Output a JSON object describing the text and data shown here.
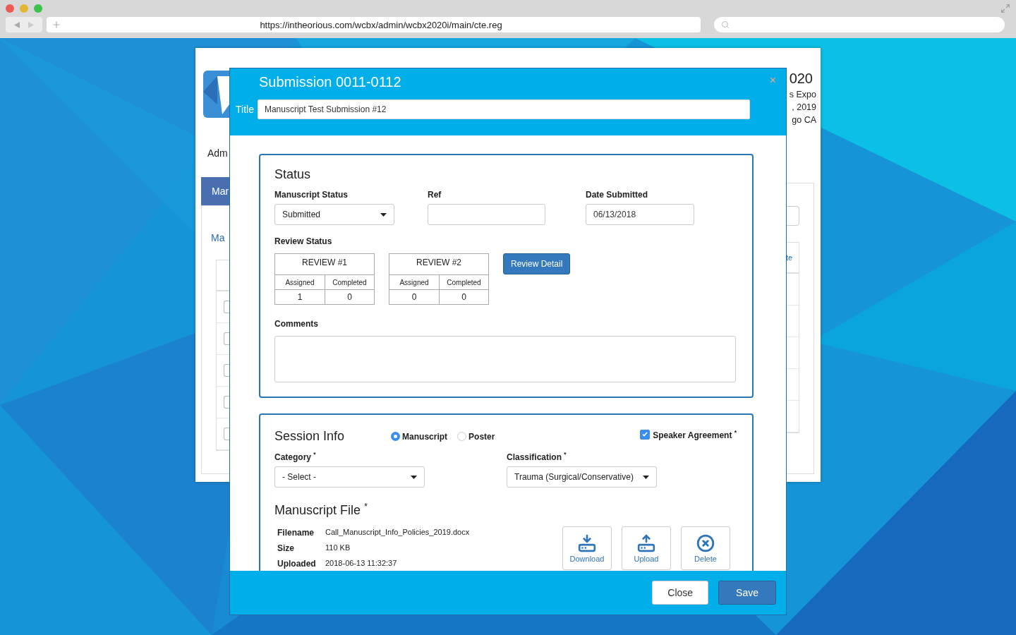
{
  "browser": {
    "url": "https://intheorious.com/wcbx/admin/wcbx2020i/main/cte.reg"
  },
  "page": {
    "rows": [
      {
        "checked": false
      },
      {
        "checked": false
      },
      {
        "checked": false
      },
      {
        "checked": false
      },
      {
        "checked": false
      }
    ],
    "header_fragments": [
      "020",
      "s Expo",
      ", 2019",
      "go CA"
    ],
    "nav_fragment": "Adm",
    "tab_fragment": "Mar",
    "link_fragment": "Ma",
    "column_fragment": "te"
  },
  "modal": {
    "title": "Submission 0011-0112",
    "close": "×",
    "title_label": "Title",
    "title_value": "Manuscript Test Submission #12",
    "status": {
      "heading": "Status",
      "fields": [
        {
          "kind": "select",
          "label": "Manuscript Status",
          "value": "Submitted"
        },
        {
          "kind": "text",
          "label": "Ref"
        },
        {
          "kind": "text",
          "label": "Date Submitted",
          "value": "06/13/2018"
        }
      ],
      "review_label": "Review Status",
      "reviews": [
        {
          "title": "REVIEW #1",
          "columns": [
            "Assigned",
            "Completed"
          ],
          "values": [
            "1",
            "0"
          ]
        },
        {
          "title": "REVIEW #2",
          "columns": [
            "Assigned",
            "Completed"
          ],
          "values": [
            "0",
            "0"
          ]
        }
      ],
      "review_button": "Review Detail",
      "comments_label": "Comments"
    },
    "session": {
      "heading": "Session Info",
      "types": [
        {
          "label": "Manuscript",
          "selected": true
        },
        {
          "label": "Poster",
          "selected": false
        }
      ],
      "agreement": {
        "label": "Speaker Agreement $^{*}$",
        "checked": true
      },
      "selects": [
        {
          "label": "Category $^{*}$",
          "value": "- Select -"
        },
        {
          "label": "Classification $^{*}$",
          "value": "Trauma (Surgical/Conservative)"
        }
      ]
    },
    "file": {
      "heading": "Manuscript File $^{*}$",
      "rows": [
        {
          "label": "Filename",
          "value": "Call_Manuscript_Info_Policies_2019.docx"
        },
        {
          "label": "Size",
          "value": "110 KB"
        },
        {
          "label": "Uploaded",
          "value": "2018-06-13 11:32:37"
        }
      ],
      "actions": [
        {
          "kind": "download",
          "label": "Download"
        },
        {
          "kind": "upload",
          "label": "Upload"
        },
        {
          "kind": "delete",
          "label": "Delete"
        }
      ]
    },
    "footer": [
      {
        "kind": "secondary",
        "label": "Close"
      },
      {
        "kind": "primary",
        "label": "Save"
      }
    ]
  }
}
